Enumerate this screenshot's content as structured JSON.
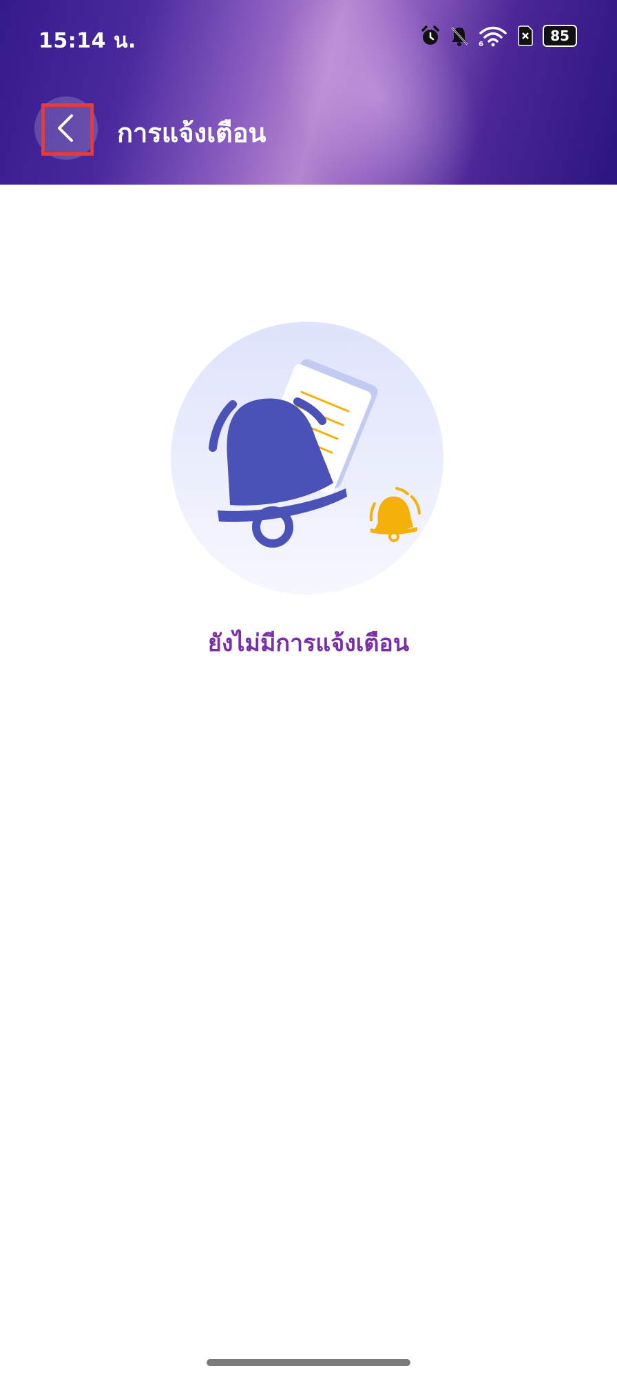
{
  "status_bar": {
    "time": "15:14 น.",
    "battery": "85",
    "icons": [
      "alarm-icon",
      "bell-muted-icon",
      "wifi-icon",
      "sim-icon",
      "battery-icon"
    ]
  },
  "header": {
    "title": "การแจ้งเตือน",
    "back_icon": "chevron-left-icon"
  },
  "empty_state": {
    "message": "ยังไม่มีการแจ้งเตือน",
    "illustration": "bell-notification-illustration"
  },
  "colors": {
    "accent_text": "#7a2ea8",
    "header_dark": "#351a8c",
    "bell_blue": "#4a52b8",
    "bell_yellow": "#f5b10a"
  }
}
